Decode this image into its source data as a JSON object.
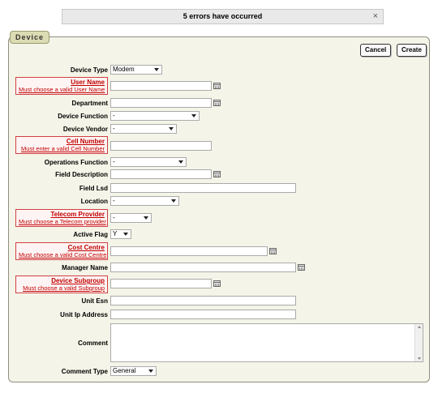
{
  "error_banner": {
    "message": "5 errors have occurred",
    "close": "×"
  },
  "panel": {
    "legend": "Device"
  },
  "buttons": {
    "cancel": "Cancel",
    "create": "Create"
  },
  "fields": {
    "device_type": {
      "label": "Device Type",
      "value": "Modem"
    },
    "user_name": {
      "label": "User Name",
      "error": "Must choose a valid User Name",
      "value": ""
    },
    "department": {
      "label": "Department",
      "value": ""
    },
    "device_function": {
      "label": "Device Function",
      "value": "-"
    },
    "device_vendor": {
      "label": "Device Vendor",
      "value": "-"
    },
    "cell_number": {
      "label": "Cell Number",
      "error": "Must enter a valid Cell Number",
      "value": ""
    },
    "operations_function": {
      "label": "Operations Function",
      "value": "-"
    },
    "field_description": {
      "label": "Field Description",
      "value": ""
    },
    "field_lsd": {
      "label": "Field Lsd",
      "value": ""
    },
    "location": {
      "label": "Location",
      "value": "-"
    },
    "telecom_provider": {
      "label": "Telecom Provider",
      "error": "Must choose a Telecom provider",
      "value": "-"
    },
    "active_flag": {
      "label": "Active Flag",
      "value": "Y"
    },
    "cost_centre": {
      "label": "Cost Centre",
      "error": "Must choose a valid Cost Centre",
      "value": ""
    },
    "manager_name": {
      "label": "Manager Name",
      "value": ""
    },
    "device_subgroup": {
      "label": "Device Subgroup",
      "error": "Must choose a valid Subgroup",
      "value": ""
    },
    "unit_esn": {
      "label": "Unit Esn",
      "value": ""
    },
    "unit_ip_address": {
      "label": "Unit Ip Address",
      "value": ""
    },
    "comment": {
      "label": "Comment",
      "value": ""
    },
    "comment_type": {
      "label": "Comment Type",
      "value": "General"
    }
  },
  "icons": {
    "lookup": "calendar-lookup-icon",
    "dropdown": "chevron-down-icon",
    "close": "close-icon"
  },
  "colors": {
    "error": "#c00000",
    "panel_bg": "#f4f4e8",
    "legend_bg": "#dcdcb4"
  }
}
